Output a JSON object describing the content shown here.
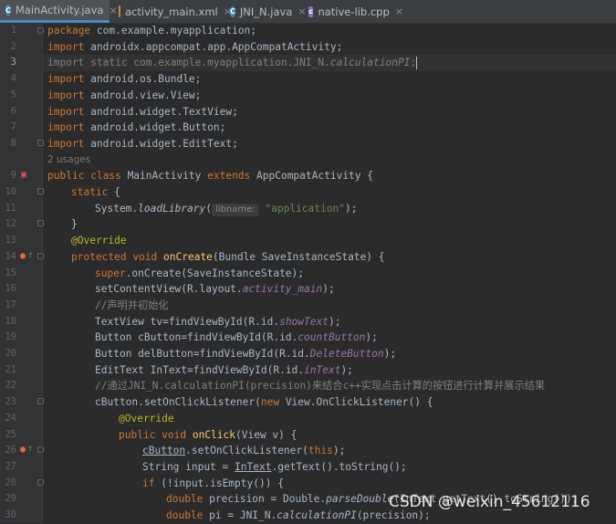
{
  "tabs": [
    {
      "label": "MainActivity.java",
      "icon": "java-class-icon",
      "active": true
    },
    {
      "label": "activity_main.xml",
      "icon": "xml-file-icon",
      "active": false
    },
    {
      "label": "JNI_N.java",
      "icon": "java-class-icon",
      "active": false
    },
    {
      "label": "native-lib.cpp",
      "icon": "cpp-file-icon",
      "active": false
    }
  ],
  "tab_close_glyph": "×",
  "line_numbers": [
    "1",
    "2",
    "3",
    "4",
    "5",
    "6",
    "7",
    "8",
    "9",
    "10",
    "11",
    "12",
    "13",
    "14",
    "15",
    "16",
    "17",
    "18",
    "19",
    "20",
    "21",
    "22",
    "23",
    "24",
    "25",
    "26",
    "27",
    "28",
    "29",
    "30"
  ],
  "usages_hint": "2 usages",
  "code": {
    "l1": {
      "kw": "package",
      "rest": " com.example.myapplication;"
    },
    "l2": {
      "kw": "import",
      "rest": " androidx.appcompat.app.AppCompatActivity;"
    },
    "l3": {
      "text": "import static com.example.myapplication.JNI_N.",
      "italic": "calculationPI",
      "end": ";"
    },
    "l4": {
      "kw": "import",
      "rest": " android.os.Bundle;"
    },
    "l5": {
      "kw": "import",
      "rest": " android.view.View;"
    },
    "l6": {
      "kw": "import",
      "rest": " android.widget.TextView;"
    },
    "l7": {
      "kw": "import",
      "rest": " android.widget.Button;"
    },
    "l8": {
      "kw": "import",
      "rest": " android.widget.EditText;"
    },
    "l9": {
      "kw1": "public class",
      "name": " MainActivity ",
      "kw2": "extends",
      "rest": " AppCompatActivity {"
    },
    "l10": {
      "kw": "static",
      "rest": " {"
    },
    "l11": {
      "pre": "System.",
      "method": "loadLibrary",
      "paren": "(",
      "hint": "libname:",
      "str": "\"application\"",
      "end": ");"
    },
    "l12": {
      "rest": "}"
    },
    "l13": {
      "ann": "@Override"
    },
    "l14": {
      "kw": "protected void",
      "fn": " onCreate",
      "rest": "(Bundle SaveInstanceState) {"
    },
    "l15": {
      "kw": "super",
      "rest": ".onCreate(SaveInstanceState);"
    },
    "l16": {
      "pre": "setContentView(R.layout.",
      "field": "activity_main",
      "end": ");"
    },
    "l17": {
      "comment": "//声明并初始化"
    },
    "l18": {
      "pre": "TextView tv=findViewById(R.id.",
      "field": "showText",
      "end": ");"
    },
    "l19": {
      "pre": "Button cButton=findViewById(R.id.",
      "field": "countButton",
      "end": ");"
    },
    "l20": {
      "pre": "Button delButton=findViewById(R.id.",
      "field": "DeleteButton",
      "end": ");"
    },
    "l21": {
      "pre": "EditText InText=findViewById(R.id.",
      "field": "inText",
      "end": ");"
    },
    "l22": {
      "comment": "//通过JNI_N.calculationPI(precision)来结合c++实现点击计算的按钮进行计算并展示结果"
    },
    "l23": {
      "pre": "cButton.setOnClickListener(",
      "kw": "new",
      "rest": " View.OnClickListener() {"
    },
    "l24": {
      "ann": "@Override"
    },
    "l25": {
      "kw": "public void",
      "fn": " onClick",
      "rest": "(View v) {"
    },
    "l26": {
      "und": "cButton",
      "pre": ".setOnClickListener(",
      "kw": "this",
      "end": ");"
    },
    "l27": {
      "pre": "String input = ",
      "und": "InText",
      "rest": ".getText().toString();"
    },
    "l28": {
      "kw": "if",
      "rest": " (!input.isEmpty()) {"
    },
    "l29": {
      "kw": "double",
      "pre": " precision = Double.",
      "method": "parseDouble",
      "rest": "(InText.getText().toString());"
    },
    "l30": {
      "kw": "double",
      "pre": " pi = JNI_N.",
      "method": "calculationPI",
      "rest": "(precision);"
    }
  },
  "watermark": "CSDN @weixin_45612116",
  "colors": {
    "editor_bg": "#2b2b2b",
    "keyword": "#cc7832",
    "string": "#6a8759",
    "annotation": "#bbb529",
    "method_decl": "#ffc66d",
    "field": "#9876aa",
    "comment": "#808080",
    "default_text": "#a9b7c6"
  }
}
